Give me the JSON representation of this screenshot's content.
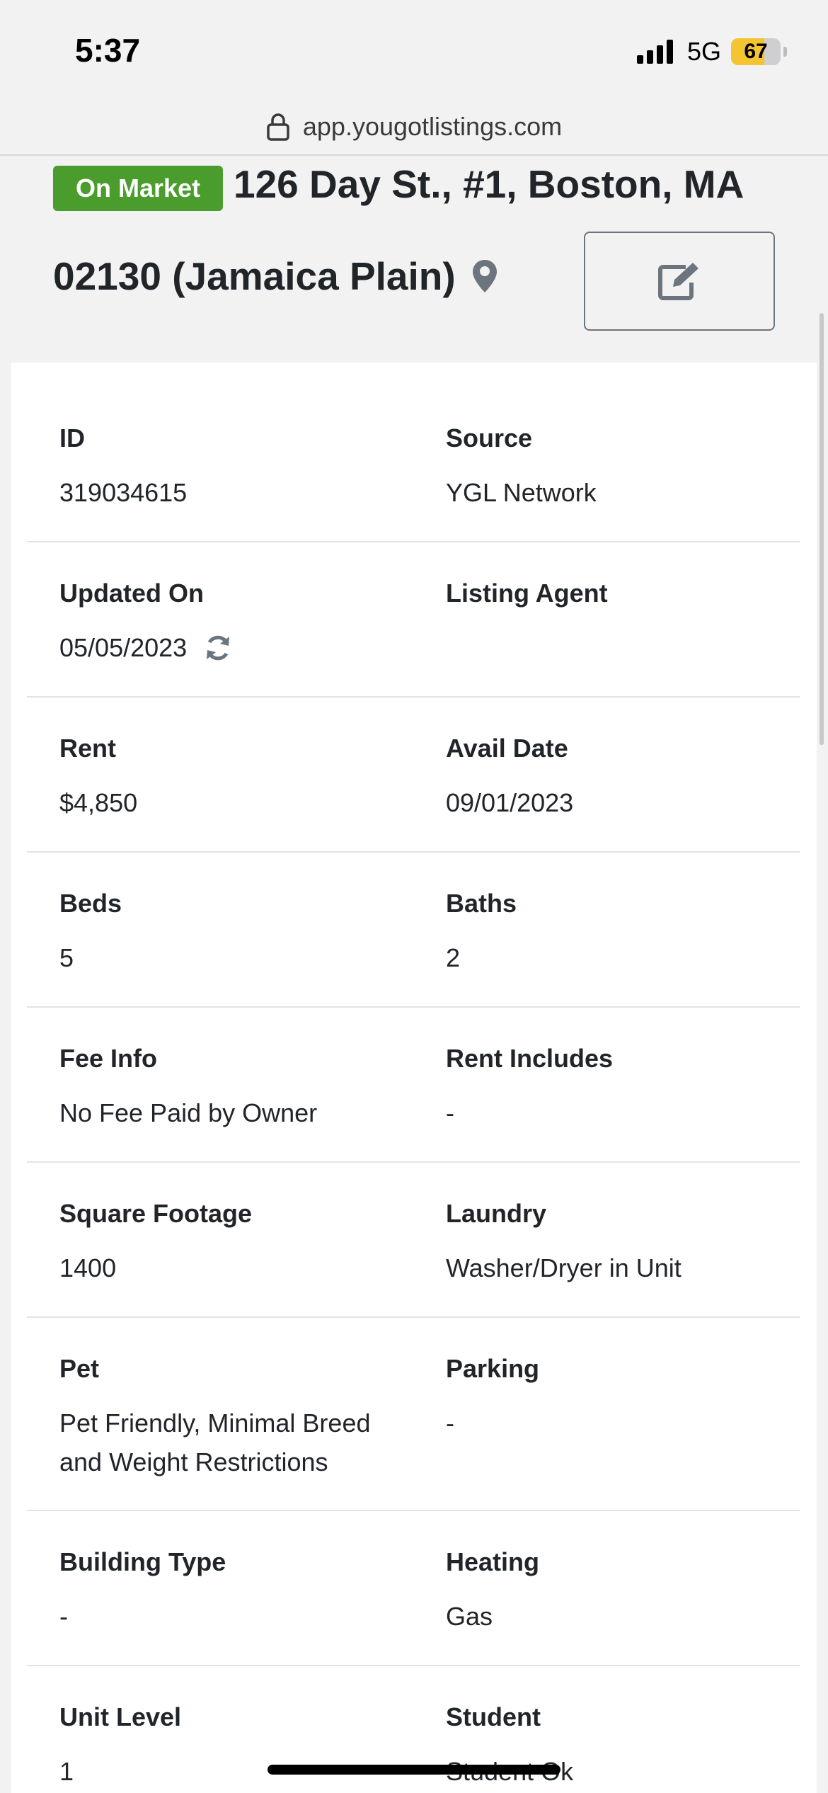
{
  "status_bar": {
    "time": "5:37",
    "network": "5G",
    "battery": "67",
    "battery_level": 0.67
  },
  "url_bar": {
    "url": "app.yougotlistings.com"
  },
  "header": {
    "badge": "On Market",
    "address_line1": "126 Day St., #1, Boston, MA",
    "address_line2": "02130 (Jamaica Plain)"
  },
  "details": [
    {
      "left": {
        "label": "ID",
        "value": "319034615"
      },
      "right": {
        "label": "Source",
        "value": "YGL Network"
      }
    },
    {
      "left": {
        "label": "Updated On",
        "value": "05/05/2023"
      },
      "right": {
        "label": "Listing Agent",
        "value": ""
      }
    },
    {
      "left": {
        "label": "Rent",
        "value": "$4,850"
      },
      "right": {
        "label": "Avail Date",
        "value": "09/01/2023"
      }
    },
    {
      "left": {
        "label": "Beds",
        "value": "5"
      },
      "right": {
        "label": "Baths",
        "value": "2"
      }
    },
    {
      "left": {
        "label": "Fee Info",
        "value": "No Fee Paid by Owner"
      },
      "right": {
        "label": "Rent Includes",
        "value": "-"
      }
    },
    {
      "left": {
        "label": "Square Footage",
        "value": "1400"
      },
      "right": {
        "label": "Laundry",
        "value": "Washer/Dryer in Unit"
      }
    },
    {
      "left": {
        "label": "Pet",
        "value": "Pet Friendly, Minimal Breed and Weight Restrictions"
      },
      "right": {
        "label": "Parking",
        "value": "-"
      }
    },
    {
      "left": {
        "label": "Building Type",
        "value": "-"
      },
      "right": {
        "label": "Heating",
        "value": "Gas"
      }
    },
    {
      "left": {
        "label": "Unit Level",
        "value": "1"
      },
      "right": {
        "label": "Student",
        "value": "Student Ok"
      }
    }
  ],
  "colors": {
    "badge": "#4a9d2c",
    "text": "#212529",
    "icon": "#6c757d"
  }
}
